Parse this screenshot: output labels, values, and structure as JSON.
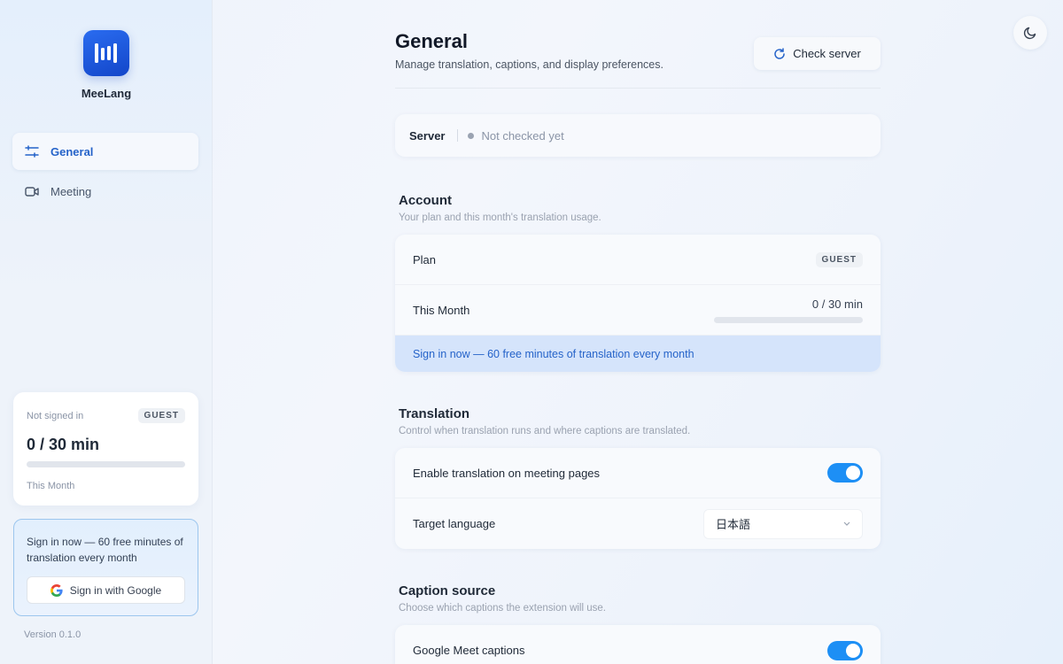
{
  "app": {
    "name": "MeeLang",
    "version": "Version 0.1.0"
  },
  "sidebar": {
    "nav": [
      {
        "label": "General",
        "icon": "sliders-icon",
        "active": true
      },
      {
        "label": "Meeting",
        "icon": "video-icon",
        "active": false
      }
    ],
    "usage": {
      "status": "Not signed in",
      "badge": "GUEST",
      "value": "0 / 30 min",
      "progress": 0,
      "caption": "This Month"
    },
    "signin": {
      "text": "Sign in now — 60 free minutes of translation every month",
      "button": "Sign in with Google"
    }
  },
  "header": {
    "title": "General",
    "subtitle": "Manage translation, captions, and display preferences.",
    "check_button": "Check server"
  },
  "server": {
    "label": "Server",
    "status": "Not checked yet"
  },
  "account": {
    "title": "Account",
    "subtitle": "Your plan and this month's translation usage.",
    "plan_label": "Plan",
    "plan_badge": "GUEST",
    "month_label": "This Month",
    "month_value": "0 / 30 min",
    "month_progress": 0,
    "promo": "Sign in now — 60 free minutes of translation every month"
  },
  "translation": {
    "title": "Translation",
    "subtitle": "Control when translation runs and where captions are translated.",
    "enable_label": "Enable translation on meeting pages",
    "enable_on": true,
    "target_label": "Target language",
    "target_value": "日本語"
  },
  "caption": {
    "title": "Caption source",
    "subtitle": "Choose which captions the extension will use.",
    "meet_label": "Google Meet captions",
    "meet_on": true
  },
  "colors": {
    "accent": "#2563c9",
    "toggle": "#1d8ff5",
    "brand": "#1d4fd8"
  }
}
